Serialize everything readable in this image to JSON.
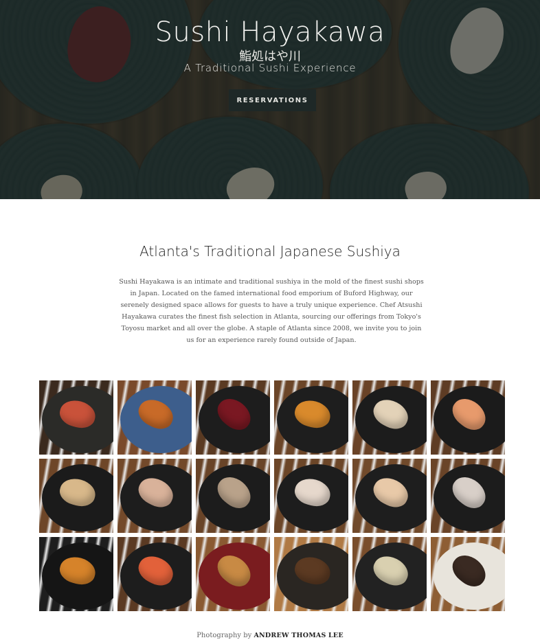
{
  "hero": {
    "title": "Sushi Hayakawa",
    "japanese_name": "鮨処はや川",
    "subtitle": "A Traditional Sushi Experience",
    "reservations_label": "RESERVATIONS"
  },
  "intro": {
    "heading": "Atlanta's Traditional Japanese Sushiya",
    "body": "Sushi Hayakawa is an intimate and traditional sushiya in the mold of the finest sushi shops in Japan. Located on the famed international food emporium of Buford Highway, our serenely designed space allows for guests to have a truly unique experience. Chef Atsushi Hayakawa curates the finest fish selection in Atlanta, sourcing our offerings from Tokyo's Toyosu market and all over the globe. A staple of Atlanta since 2008, we invite you to join us for an experience rarely found outside of Japan."
  },
  "gallery": {
    "photos": [
      {
        "name": "photo-sashimi-platter",
        "bg": "#3b2a1e",
        "plate": "#2b2b28",
        "piece": "#c9523a"
      },
      {
        "name": "photo-uni-ikura-bowl",
        "bg": "#7a4a2b",
        "plate": "#3d5e8c",
        "piece": "#c86a28"
      },
      {
        "name": "photo-akami-nigiri",
        "bg": "#5a3a22",
        "plate": "#1d1d1d",
        "piece": "#7a1822"
      },
      {
        "name": "photo-uni-nigiri",
        "bg": "#6b4528",
        "plate": "#1e1e1e",
        "piece": "#d98a2c"
      },
      {
        "name": "photo-hirame-nigiri",
        "bg": "#6a4327",
        "plate": "#1c1c1c",
        "piece": "#e3d2b8"
      },
      {
        "name": "photo-sake-nigiri",
        "bg": "#5e3c24",
        "plate": "#1b1b1b",
        "piece": "#e79a6c"
      },
      {
        "name": "photo-anago-nigiri",
        "bg": "#6e4628",
        "plate": "#1b1b1b",
        "piece": "#d8b88a"
      },
      {
        "name": "photo-aburi-nigiri",
        "bg": "#73492a",
        "plate": "#1d1d1d",
        "piece": "#d9b29a"
      },
      {
        "name": "photo-saba-nigiri",
        "bg": "#694428",
        "plate": "#1c1c1c",
        "piece": "#b9a28a"
      },
      {
        "name": "photo-kanpachi-nigiri",
        "bg": "#6c4628",
        "plate": "#1d1d1d",
        "piece": "#e6d8cc"
      },
      {
        "name": "photo-hamachi-nigiri",
        "bg": "#714a2b",
        "plate": "#1e1e1e",
        "piece": "#e8c9a8"
      },
      {
        "name": "photo-kohada-nigiri",
        "bg": "#6a4428",
        "plate": "#1c1c1c",
        "piece": "#d8cfc8"
      },
      {
        "name": "photo-uni-gunkan",
        "bg": "#1e1e1e",
        "plate": "#151515",
        "piece": "#d6832a"
      },
      {
        "name": "photo-ebi-nigiri",
        "bg": "#5b3a23",
        "plate": "#1d1d1d",
        "piece": "#e2613a"
      },
      {
        "name": "photo-grilled-fish",
        "bg": "#8a5a32",
        "plate": "#7a1c1f",
        "piece": "#c88a44"
      },
      {
        "name": "photo-simmered-dish",
        "bg": "#b07a45",
        "plate": "#2a2622",
        "piece": "#5c3a22"
      },
      {
        "name": "photo-roll-plate",
        "bg": "#7a4e2c",
        "plate": "#222222",
        "piece": "#d9d0b0"
      },
      {
        "name": "photo-tuna-roll",
        "bg": "#8e5e34",
        "plate": "#e8e4dc",
        "piece": "#3a2a22"
      }
    ]
  },
  "credit": {
    "prefix": "Photography by",
    "photographer": "ANDREW THOMAS LEE"
  }
}
